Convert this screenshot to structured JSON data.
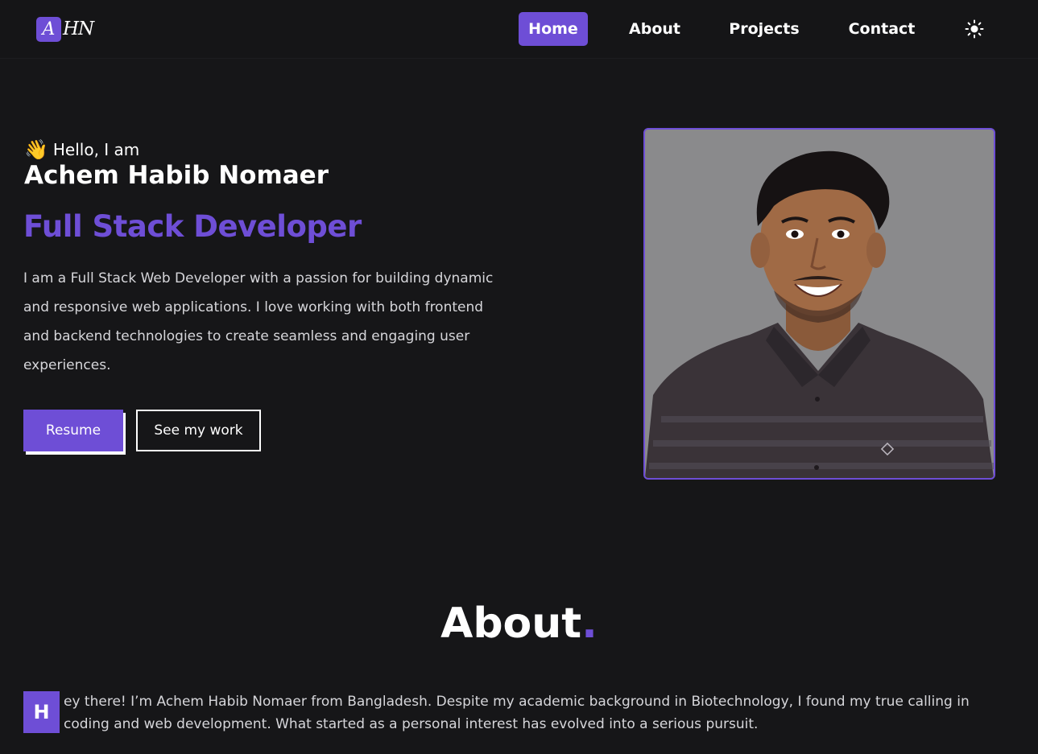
{
  "nav": {
    "logo_initial": "A",
    "logo_rest": "HN",
    "links": [
      "Home",
      "About",
      "Projects",
      "Contact"
    ],
    "active": "Home",
    "theme_icon": "sun-icon"
  },
  "hero": {
    "wave_icon": "waving-hand-icon",
    "greeting": "Hello, I am",
    "name": "Achem Habib Nomaer",
    "role": "Full Stack Developer",
    "bio": "I am a Full Stack Web Developer with a passion for building dynamic and responsive web applications. I love working with both frontend and backend technologies to create seamless and engaging user experiences.",
    "buttons": {
      "resume": "Resume",
      "work": "See my work"
    }
  },
  "about": {
    "title": "About",
    "title_dot": ".",
    "dropcap": "H",
    "text": "ey there! I’m Achem Habib Nomaer from Bangladesh. Despite my academic background in Biotechnology, I found my true calling in coding and web development. What started as a personal interest has evolved into a serious pursuit."
  },
  "colors": {
    "accent": "#6e4ed6",
    "background": "#161618"
  }
}
